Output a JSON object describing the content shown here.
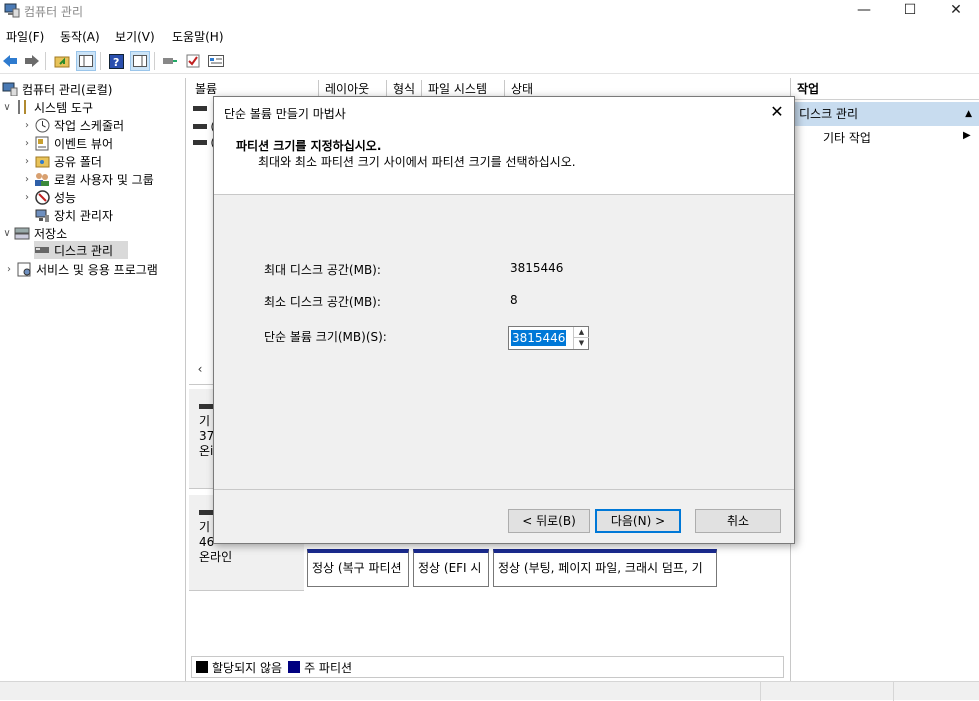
{
  "window": {
    "title": "컴퓨터 관리",
    "minimize": "—",
    "maximize": "☐",
    "close": "✕"
  },
  "menu": [
    "파일(F)",
    "동작(A)",
    "보기(V)",
    "도움말(H)"
  ],
  "tree": {
    "root": "컴퓨터 관리(로컬)",
    "system_tools": "시스템 도구",
    "task_scheduler": "작업 스케줄러",
    "event_viewer": "이벤트 뷰어",
    "shared_folders": "공유 폴더",
    "local_users": "로컬 사용자 및 그룹",
    "performance": "성능",
    "device_manager": "장치 관리자",
    "storage": "저장소",
    "disk_management": "디스크 관리",
    "services": "서비스 및 응용 프로그램"
  },
  "columns": [
    "볼륨",
    "레이아웃",
    "형식",
    "파일 시스템",
    "상태"
  ],
  "volume_rows": [
    "(",
    "("
  ],
  "disks": [
    {
      "line1": "기",
      "line2": "37",
      "line3": "온i"
    },
    {
      "line1": "기",
      "line2": "46",
      "line3": "온라인"
    }
  ],
  "partitions": [
    "정상 (복구 파티션",
    "정상 (EFI 시",
    "정상 (부팅, 페이지 파일, 크래시 덤프, 기"
  ],
  "legend": {
    "unallocated": "할당되지 않음",
    "primary": "주 파티션",
    "unallocated_color": "#000000",
    "primary_color": "#000080"
  },
  "actions": {
    "header": "작업",
    "section": "디스크 관리",
    "more": "기타 작업"
  },
  "dialog": {
    "title": "단순 볼륨 만들기 마법사",
    "heading": "파티션 크기를 지정하십시오.",
    "subheading": "최대와 최소 파티션 크기 사이에서 파티션 크기를 선택하십시오.",
    "max_label": "최대 디스크 공간(MB):",
    "max_value": "3815446",
    "min_label": "최소 디스크 공간(MB):",
    "min_value": "8",
    "size_label": "단순 볼륨 크기(MB)(S):",
    "size_value": "3815446",
    "back_button": "< 뒤로(B)",
    "next_button": "다음(N) >",
    "cancel_button": "취소"
  },
  "colors": {
    "selection": "#0078d7",
    "action_section": "#c8dcef",
    "partition_header": "#1a2a8f"
  }
}
